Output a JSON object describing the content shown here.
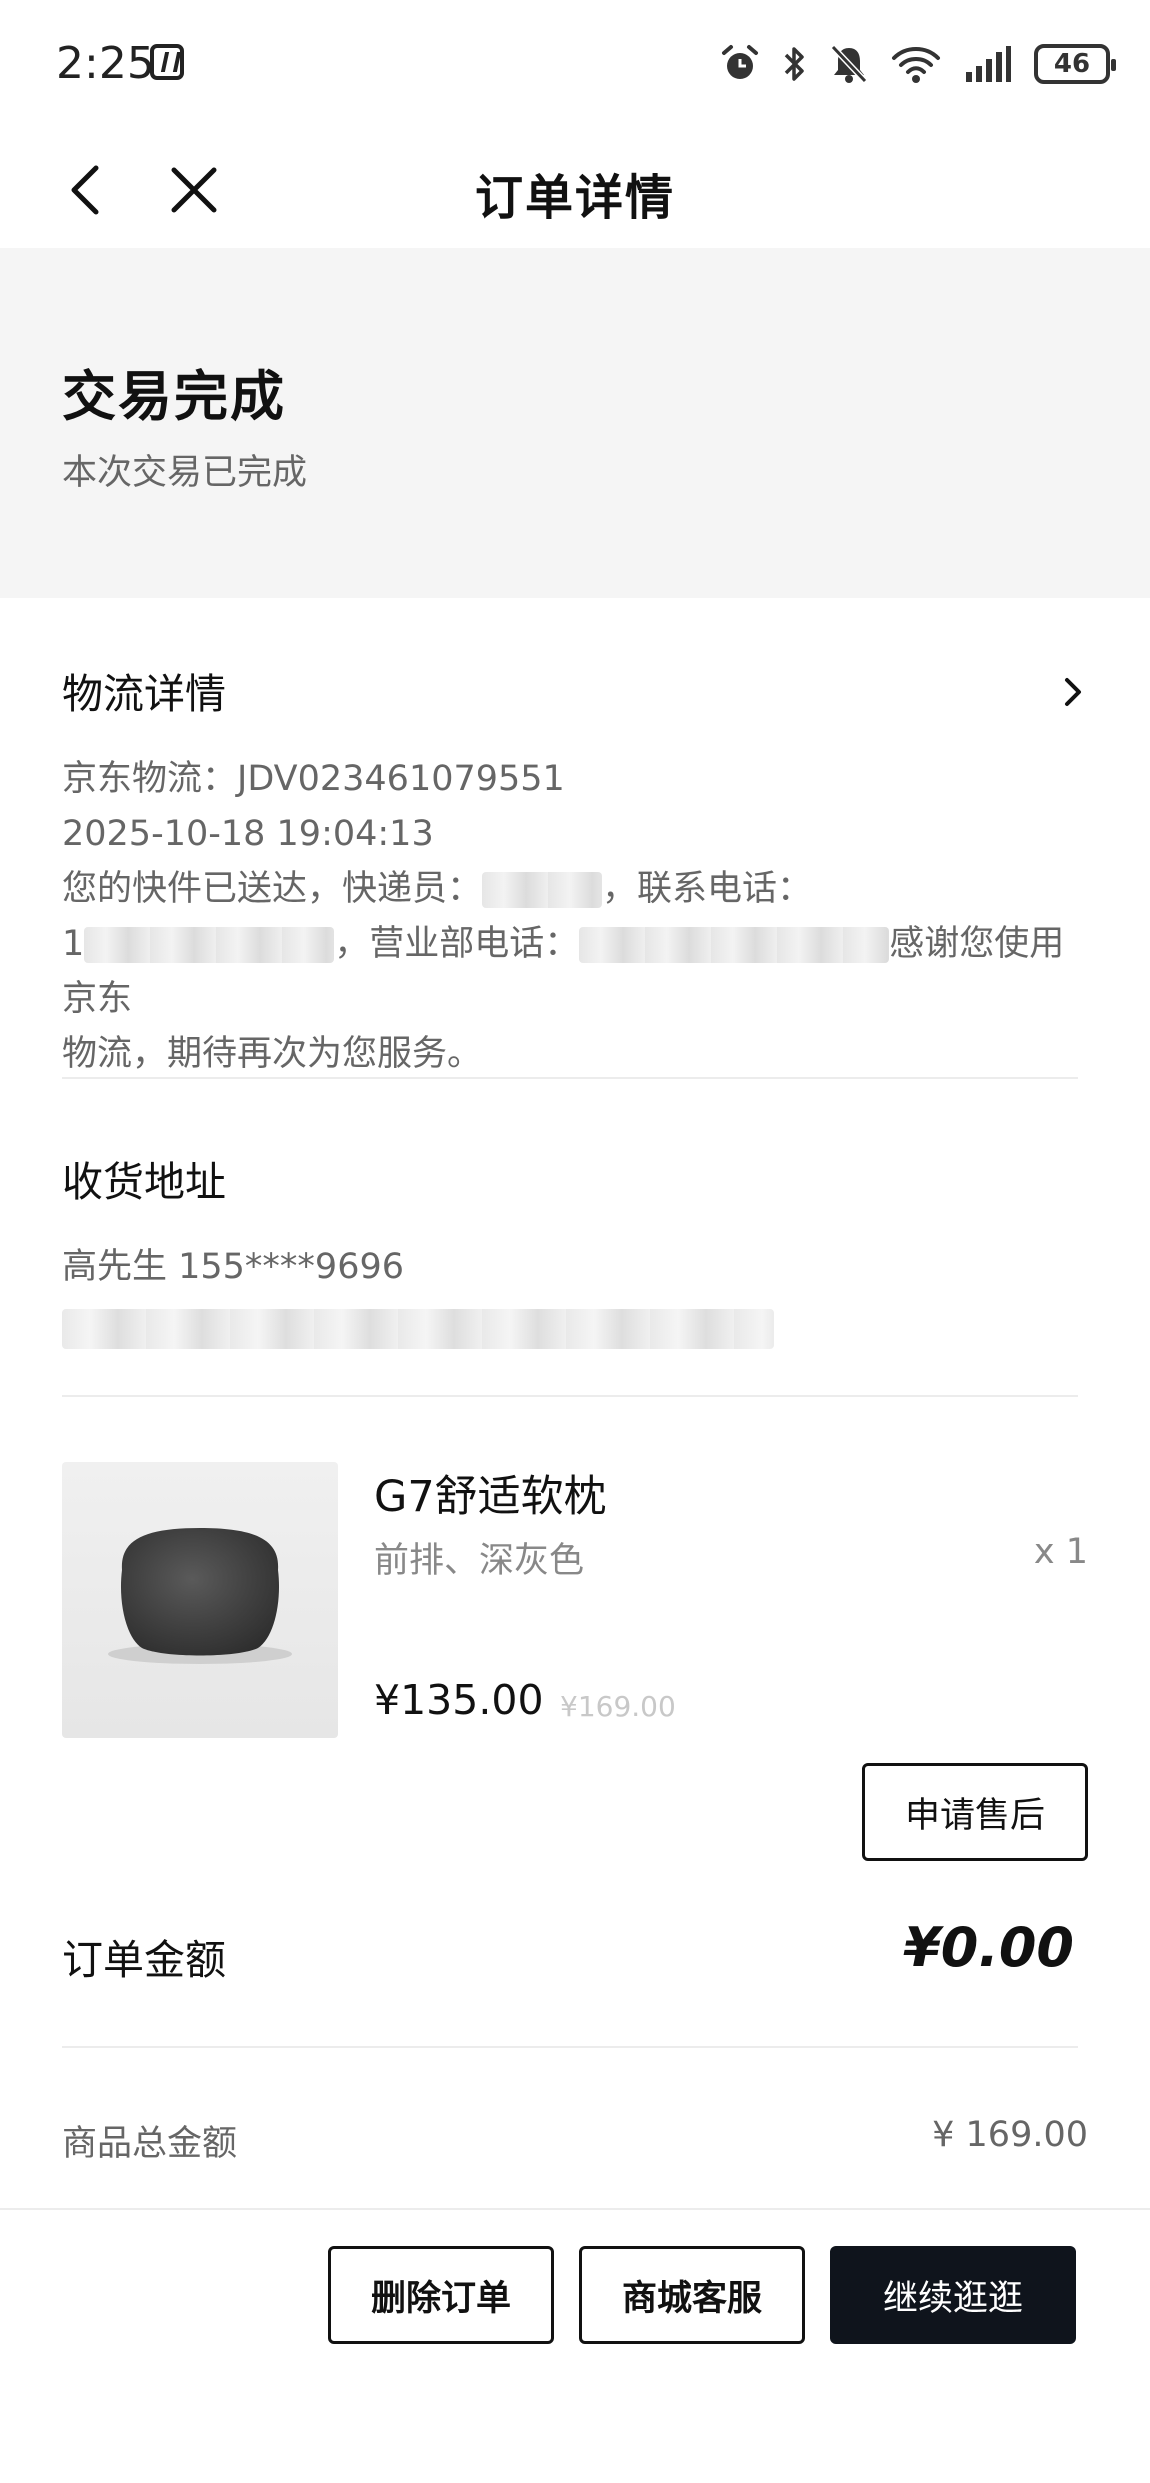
{
  "status_bar": {
    "time": "2:25",
    "battery": "46",
    "icons": [
      "nfc-icon",
      "alarm-icon",
      "bluetooth-icon",
      "mute-icon",
      "wifi-6-icon",
      "signal-icon",
      "battery-icon"
    ]
  },
  "nav": {
    "title": "订单详情",
    "icons": [
      "back-arrow-icon",
      "close-icon"
    ]
  },
  "order_status": {
    "title": "交易完成",
    "subtitle": "本次交易已完成"
  },
  "logistics": {
    "title": "物流详情",
    "tracking": "京东物流：JDV023461079551",
    "time": "2025-10-18 19:04:13",
    "message_1": "您的快件已送达，快递员：",
    "message_1b": "，联系电话：",
    "message_2a": "1",
    "message_2b": "，营业部电话：",
    "message_2c": "感谢您使用京东",
    "message_3": "物流，期待再次为您服务。"
  },
  "address": {
    "title": "收货地址",
    "name_phone": "高先生  155****9696"
  },
  "product": {
    "name": "G7舒适软枕",
    "spec": "前排、深灰色",
    "qty": "x 1",
    "price": "¥135.00",
    "original_price": "¥169.00",
    "after_sale_label": "申请售后"
  },
  "order_amount": {
    "label": "订单金额",
    "value": "¥0.00"
  },
  "goods_total": {
    "label": "商品总金额",
    "value": "¥ 169.00"
  },
  "actions": {
    "delete": "删除订单",
    "service": "商城客服",
    "continue": "继续逛逛"
  },
  "colors": {
    "primary_button": "#0f141c",
    "status_background": "#f5f5f5",
    "secondary_text": "#666666"
  }
}
